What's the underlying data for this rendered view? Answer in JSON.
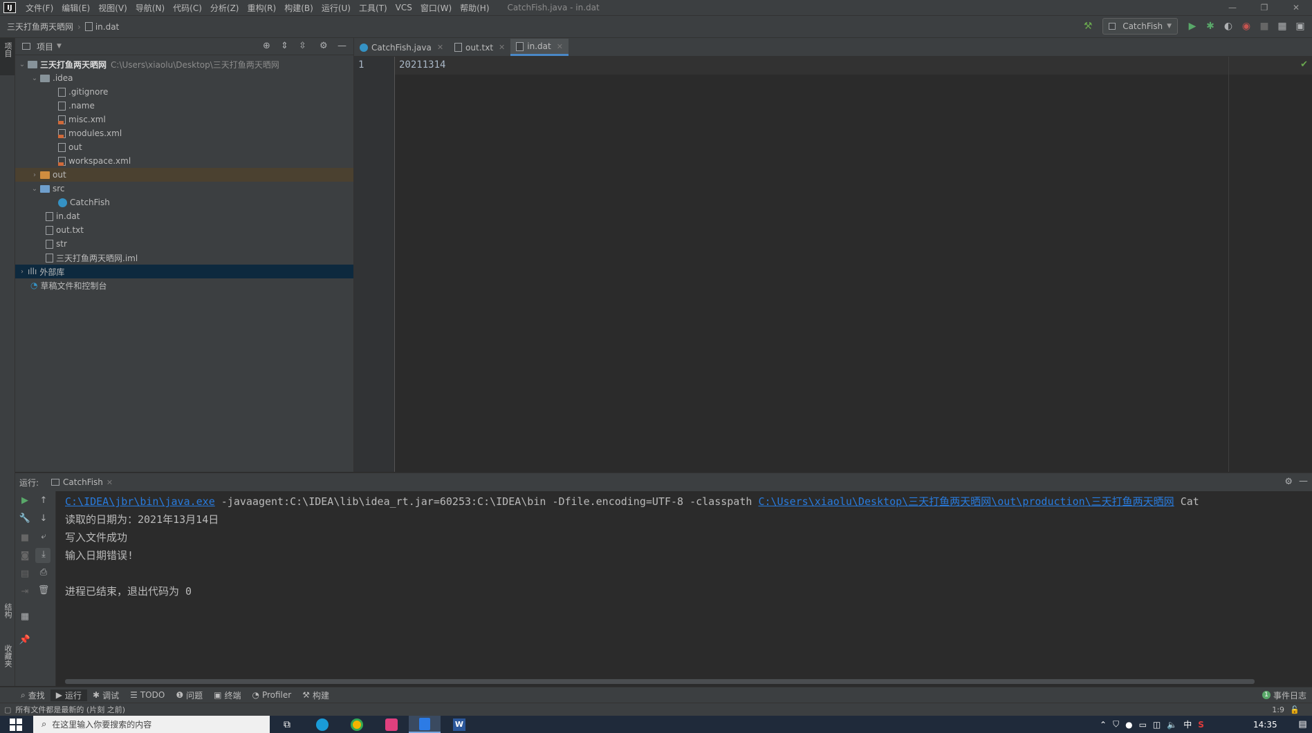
{
  "menubar": {
    "items": [
      "文件(F)",
      "编辑(E)",
      "视图(V)",
      "导航(N)",
      "代码(C)",
      "分析(Z)",
      "重构(R)",
      "构建(B)",
      "运行(U)",
      "工具(T)",
      "VCS",
      "窗口(W)",
      "帮助(H)"
    ],
    "window_title": "CatchFish.java - in.dat"
  },
  "navbar": {
    "project": "三天打鱼两天晒网",
    "file": "in.dat",
    "run_config": "CatchFish"
  },
  "side_strip": {
    "project_label": "项目",
    "structure_label": "结构",
    "favorites_label": "收藏夹"
  },
  "project_panel": {
    "title": "项目",
    "tree": [
      {
        "label": "三天打鱼两天晒网",
        "path": "C:\\Users\\xiaolu\\Desktop\\三天打鱼两天晒网",
        "icon": "module-folder-icon",
        "expanded": true
      },
      {
        "label": ".idea",
        "icon": "folder-icon",
        "expanded": true
      },
      {
        "label": ".gitignore",
        "icon": "file-icon"
      },
      {
        "label": ".name",
        "icon": "file-icon"
      },
      {
        "label": "misc.xml",
        "icon": "xml-file-icon"
      },
      {
        "label": "modules.xml",
        "icon": "xml-file-icon"
      },
      {
        "label": "out",
        "icon": "file-icon"
      },
      {
        "label": "workspace.xml",
        "icon": "xml-file-icon"
      },
      {
        "label": "out",
        "icon": "excluded-folder-icon",
        "expanded": false
      },
      {
        "label": "src",
        "icon": "source-folder-icon",
        "expanded": true
      },
      {
        "label": "CatchFish",
        "icon": "java-class-icon"
      },
      {
        "label": "in.dat",
        "icon": "file-icon"
      },
      {
        "label": "out.txt",
        "icon": "file-icon"
      },
      {
        "label": "str",
        "icon": "file-icon"
      },
      {
        "label": "三天打鱼两天晒网.iml",
        "icon": "module-file-icon"
      },
      {
        "label": "外部库",
        "icon": "library-icon",
        "expanded": false
      },
      {
        "label": "草稿文件和控制台",
        "icon": "scratches-icon"
      }
    ]
  },
  "editor": {
    "tabs": [
      {
        "label": "CatchFish.java",
        "active": false
      },
      {
        "label": "out.txt",
        "active": false
      },
      {
        "label": "in.dat",
        "active": true
      }
    ],
    "line_number": "1",
    "content": "20211314"
  },
  "run_panel": {
    "label": "运行:",
    "tab": "CatchFish",
    "console": {
      "cmd_link1": "C:\\IDEA\\jbr\\bin\\java.exe",
      "cmd_mid": " -javaagent:C:\\IDEA\\lib\\idea_rt.jar=60253:C:\\IDEA\\bin -Dfile.encoding=UTF-8 -classpath ",
      "cmd_link2": "C:\\Users\\xiaolu\\Desktop\\三天打鱼两天晒网\\out\\production\\三天打鱼两天晒网",
      "cmd_tail": " Cat",
      "line1": "读取的日期为：2021年13月14日",
      "line2": "写入文件成功",
      "line3": "输入日期错误!",
      "line4": "进程已结束，退出代码为 0"
    }
  },
  "bottom_tools": {
    "find": "查找",
    "run": "运行",
    "debug": "调试",
    "todo": "TODO",
    "problems": "问题",
    "terminal": "终端",
    "profiler": "Profiler",
    "build": "构建",
    "event_log": "事件日志",
    "event_count": "1"
  },
  "status": {
    "message": "所有文件都是最新的 (片刻 之前)",
    "position": "1:9"
  },
  "taskbar": {
    "search_placeholder": "在这里输入你要搜索的内容",
    "time": "14:35",
    "ime": "中"
  },
  "colors": {
    "accent": "#4a88c7",
    "link": "#287bde",
    "taskbar": "#1f2a3a"
  }
}
